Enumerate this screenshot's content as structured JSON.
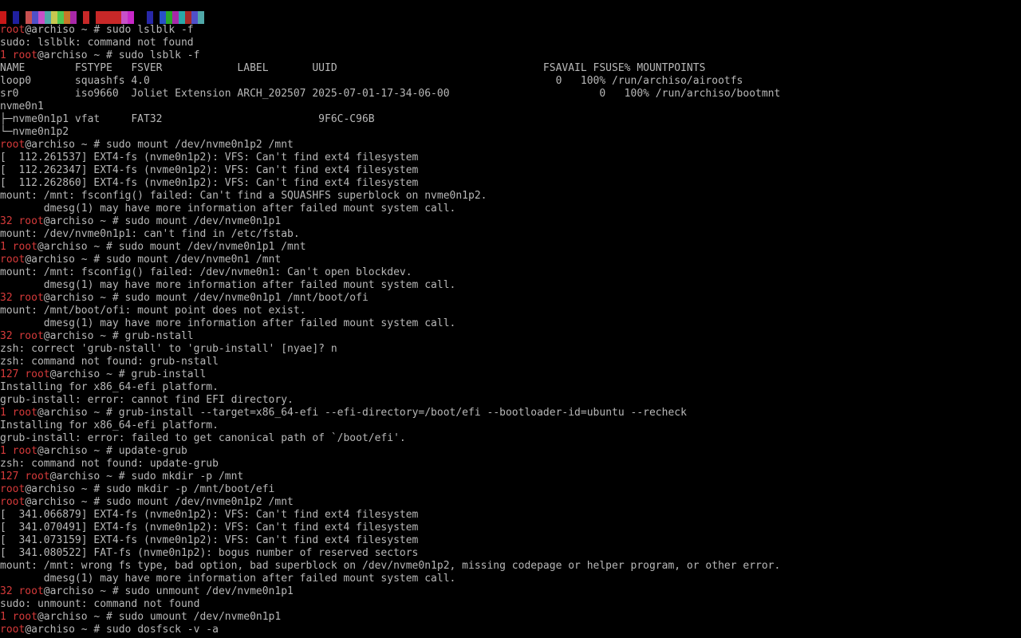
{
  "palette": [
    "#c81818",
    "#000000",
    "#2020a0",
    "#000000",
    "#c85050",
    "#5050c8",
    "#c850c8",
    "#50a8a8",
    "#c8c850",
    "#50c850",
    "#c87828",
    "#a828a8",
    "#000000",
    "#c82828",
    "#000000",
    "#c82828",
    "#c82828",
    "#c82828",
    "#c82828",
    "#c850c8",
    "#c828c8",
    "#000000",
    "#000000",
    "#2828a8",
    "#000000",
    "#2850c8",
    "#28a828",
    "#a828a8",
    "#28a8a8",
    "#a82828",
    "#5050c8",
    "#50a8a8"
  ],
  "colors": {
    "error": "#d63a3a",
    "text": "#b8b8b8",
    "background": "#000000"
  },
  "lines": [
    {
      "code": "",
      "user": "root",
      "rest": "@archiso ~ # sudo lslblk -f"
    },
    {
      "code": "",
      "user": "",
      "rest": "sudo: lslblk: command not found"
    },
    {
      "code": "1 ",
      "user": "root",
      "rest": "@archiso ~ # sudo lsblk -f"
    },
    {
      "code": "",
      "user": "",
      "rest": "NAME        FSTYPE   FSVER            LABEL       UUID                                 FSAVAIL FSUSE% MOUNTPOINTS"
    },
    {
      "code": "",
      "user": "",
      "rest": "loop0       squashfs 4.0                                                                 0   100% /run/archiso/airootfs"
    },
    {
      "code": "",
      "user": "",
      "rest": "sr0         iso9660  Joliet Extension ARCH_202507 2025-07-01-17-34-06-00                        0   100% /run/archiso/bootmnt"
    },
    {
      "code": "",
      "user": "",
      "rest": "nvme0n1"
    },
    {
      "code": "",
      "user": "",
      "rest": "├─nvme0n1p1 vfat     FAT32                         9F6C-C96B"
    },
    {
      "code": "",
      "user": "",
      "rest": "└─nvme0n1p2"
    },
    {
      "code": "",
      "user": "root",
      "rest": "@archiso ~ # sudo mount /dev/nvme0n1p2 /mnt"
    },
    {
      "code": "",
      "user": "",
      "rest": "[  112.261537] EXT4-fs (nvme0n1p2): VFS: Can't find ext4 filesystem"
    },
    {
      "code": "",
      "user": "",
      "rest": "[  112.262347] EXT4-fs (nvme0n1p2): VFS: Can't find ext4 filesystem"
    },
    {
      "code": "",
      "user": "",
      "rest": "[  112.262860] EXT4-fs (nvme0n1p2): VFS: Can't find ext4 filesystem"
    },
    {
      "code": "",
      "user": "",
      "rest": "mount: /mnt: fsconfig() failed: Can't find a SQUASHFS superblock on nvme0n1p2."
    },
    {
      "code": "",
      "user": "",
      "rest": "       dmesg(1) may have more information after failed mount system call."
    },
    {
      "code": "32 ",
      "user": "root",
      "rest": "@archiso ~ # sudo mount /dev/nvme0n1p1"
    },
    {
      "code": "",
      "user": "",
      "rest": "mount: /dev/nvme0n1p1: can't find in /etc/fstab."
    },
    {
      "code": "1 ",
      "user": "root",
      "rest": "@archiso ~ # sudo mount /dev/nvme0n1p1 /mnt"
    },
    {
      "code": "",
      "user": "root",
      "rest": "@archiso ~ # sudo mount /dev/nvme0n1 /mnt"
    },
    {
      "code": "",
      "user": "",
      "rest": "mount: /mnt: fsconfig() failed: /dev/nvme0n1: Can't open blockdev."
    },
    {
      "code": "",
      "user": "",
      "rest": "       dmesg(1) may have more information after failed mount system call."
    },
    {
      "code": "32 ",
      "user": "root",
      "rest": "@archiso ~ # sudo mount /dev/nvme0n1p1 /mnt/boot/ofi"
    },
    {
      "code": "",
      "user": "",
      "rest": "mount: /mnt/boot/ofi: mount point does not exist."
    },
    {
      "code": "",
      "user": "",
      "rest": "       dmesg(1) may have more information after failed mount system call."
    },
    {
      "code": "32 ",
      "user": "root",
      "rest": "@archiso ~ # grub-nstall"
    },
    {
      "code": "",
      "user": "",
      "rest": "zsh: correct 'grub-nstall' to 'grub-install' [nyae]? n"
    },
    {
      "code": "",
      "user": "",
      "rest": "zsh: command not found: grub-nstall"
    },
    {
      "code": "127 ",
      "user": "root",
      "rest": "@archiso ~ # grub-install"
    },
    {
      "code": "",
      "user": "",
      "rest": "Installing for x86_64-efi platform."
    },
    {
      "code": "",
      "user": "",
      "rest": "grub-install: error: cannot find EFI directory."
    },
    {
      "code": "1 ",
      "user": "root",
      "rest": "@archiso ~ # grub-install --target=x86_64-efi --efi-directory=/boot/efi --bootloader-id=ubuntu --recheck"
    },
    {
      "code": "",
      "user": "",
      "rest": "Installing for x86_64-efi platform."
    },
    {
      "code": "",
      "user": "",
      "rest": "grub-install: error: failed to get canonical path of `/boot/efi'."
    },
    {
      "code": "1 ",
      "user": "root",
      "rest": "@archiso ~ # update-grub"
    },
    {
      "code": "",
      "user": "",
      "rest": "zsh: command not found: update-grub"
    },
    {
      "code": "127 ",
      "user": "root",
      "rest": "@archiso ~ # sudo mkdir -p /mnt"
    },
    {
      "code": "",
      "user": "root",
      "rest": "@archiso ~ # sudo mkdir -p /mnt/boot/efi"
    },
    {
      "code": "",
      "user": "root",
      "rest": "@archiso ~ # sudo mount /dev/nvme0n1p2 /mnt"
    },
    {
      "code": "",
      "user": "",
      "rest": "[  341.066879] EXT4-fs (nvme0n1p2): VFS: Can't find ext4 filesystem"
    },
    {
      "code": "",
      "user": "",
      "rest": "[  341.070491] EXT4-fs (nvme0n1p2): VFS: Can't find ext4 filesystem"
    },
    {
      "code": "",
      "user": "",
      "rest": "[  341.073159] EXT4-fs (nvme0n1p2): VFS: Can't find ext4 filesystem"
    },
    {
      "code": "",
      "user": "",
      "rest": "[  341.080522] FAT-fs (nvme0n1p2): bogus number of reserved sectors"
    },
    {
      "code": "",
      "user": "",
      "rest": "mount: /mnt: wrong fs type, bad option, bad superblock on /dev/nvme0n1p2, missing codepage or helper program, or other error."
    },
    {
      "code": "",
      "user": "",
      "rest": "       dmesg(1) may have more information after failed mount system call."
    },
    {
      "code": "32 ",
      "user": "root",
      "rest": "@archiso ~ # sudo unmount /dev/nvme0n1p1"
    },
    {
      "code": "",
      "user": "",
      "rest": "sudo: unmount: command not found"
    },
    {
      "code": "1 ",
      "user": "root",
      "rest": "@archiso ~ # sudo umount /dev/nvme0n1p1"
    },
    {
      "code": "",
      "user": "root",
      "rest": "@archiso ~ # sudo dosfsck -v -a"
    }
  ]
}
